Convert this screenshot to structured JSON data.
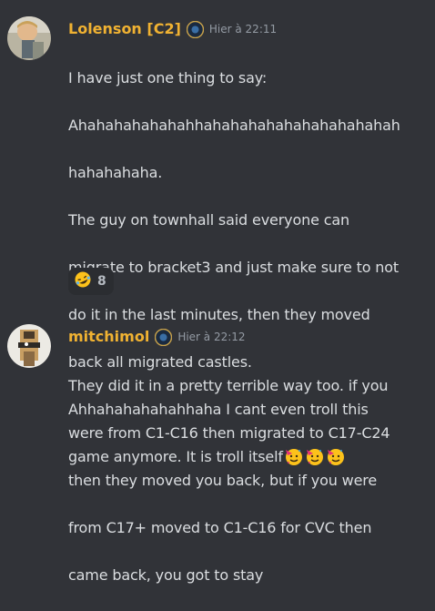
{
  "messages": [
    {
      "username": "Lolenson [C2]",
      "timestamp": "Hier à 22:11",
      "lines": [
        "I have just one thing to say:",
        "Ahahahahahahahhahahahahahahahahahahah",
        "hahahahaha.",
        "The guy on townhall said everyone can",
        "migrate to bracket3 and just make sure to not",
        "do it in the last minutes, then they moved",
        "back all migrated castles.",
        "Ahhahahahahahhaha I cant even troll this",
        "game anymore. It is troll itself"
      ],
      "emoji_name": "partying-face",
      "reaction": {
        "emoji_name": "rofl",
        "count": "8"
      }
    },
    {
      "username": "mitchimol",
      "timestamp": "Hier à 22:12",
      "lines": [
        "They did it in a pretty terrible way too. if you",
        "were from C1-C16 then migrated to C17-C24",
        "then they moved you back, but if you were",
        "from C17+ moved to C1-C16 for CVC then",
        "came back, you got to stay"
      ]
    }
  ],
  "colors": {
    "background": "#313338",
    "username": "#f0b232",
    "text": "#dbdee1",
    "timestamp": "#949ba4"
  }
}
